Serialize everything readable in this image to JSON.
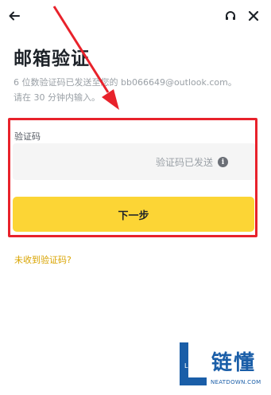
{
  "header": {
    "back_icon": "arrow-left-icon",
    "support_icon": "headset-icon",
    "close_icon": "close-icon"
  },
  "page": {
    "title": "邮箱验证",
    "description_line1": "6 位数验证码已发送至您的 bb066649@outlook.com。",
    "description_line2": "请在 30 分钟内输入。"
  },
  "form": {
    "code_label": "验证码",
    "code_value": "",
    "code_status": "验证码已发送",
    "info_icon": "info-icon",
    "next_button": "下一步",
    "resend_link": "未收到验证码?"
  },
  "annotation": {
    "arrow_color": "#e8222b",
    "highlight_color": "#e8222b"
  },
  "watermark": {
    "logo_letter": "L",
    "text_cn": "链懂",
    "text_en": "NEATDOWN.COM"
  },
  "colors": {
    "accent": "#fcd535",
    "link": "#d9a400",
    "input_bg": "#f5f5f5",
    "muted_text": "#9aa0a6"
  }
}
